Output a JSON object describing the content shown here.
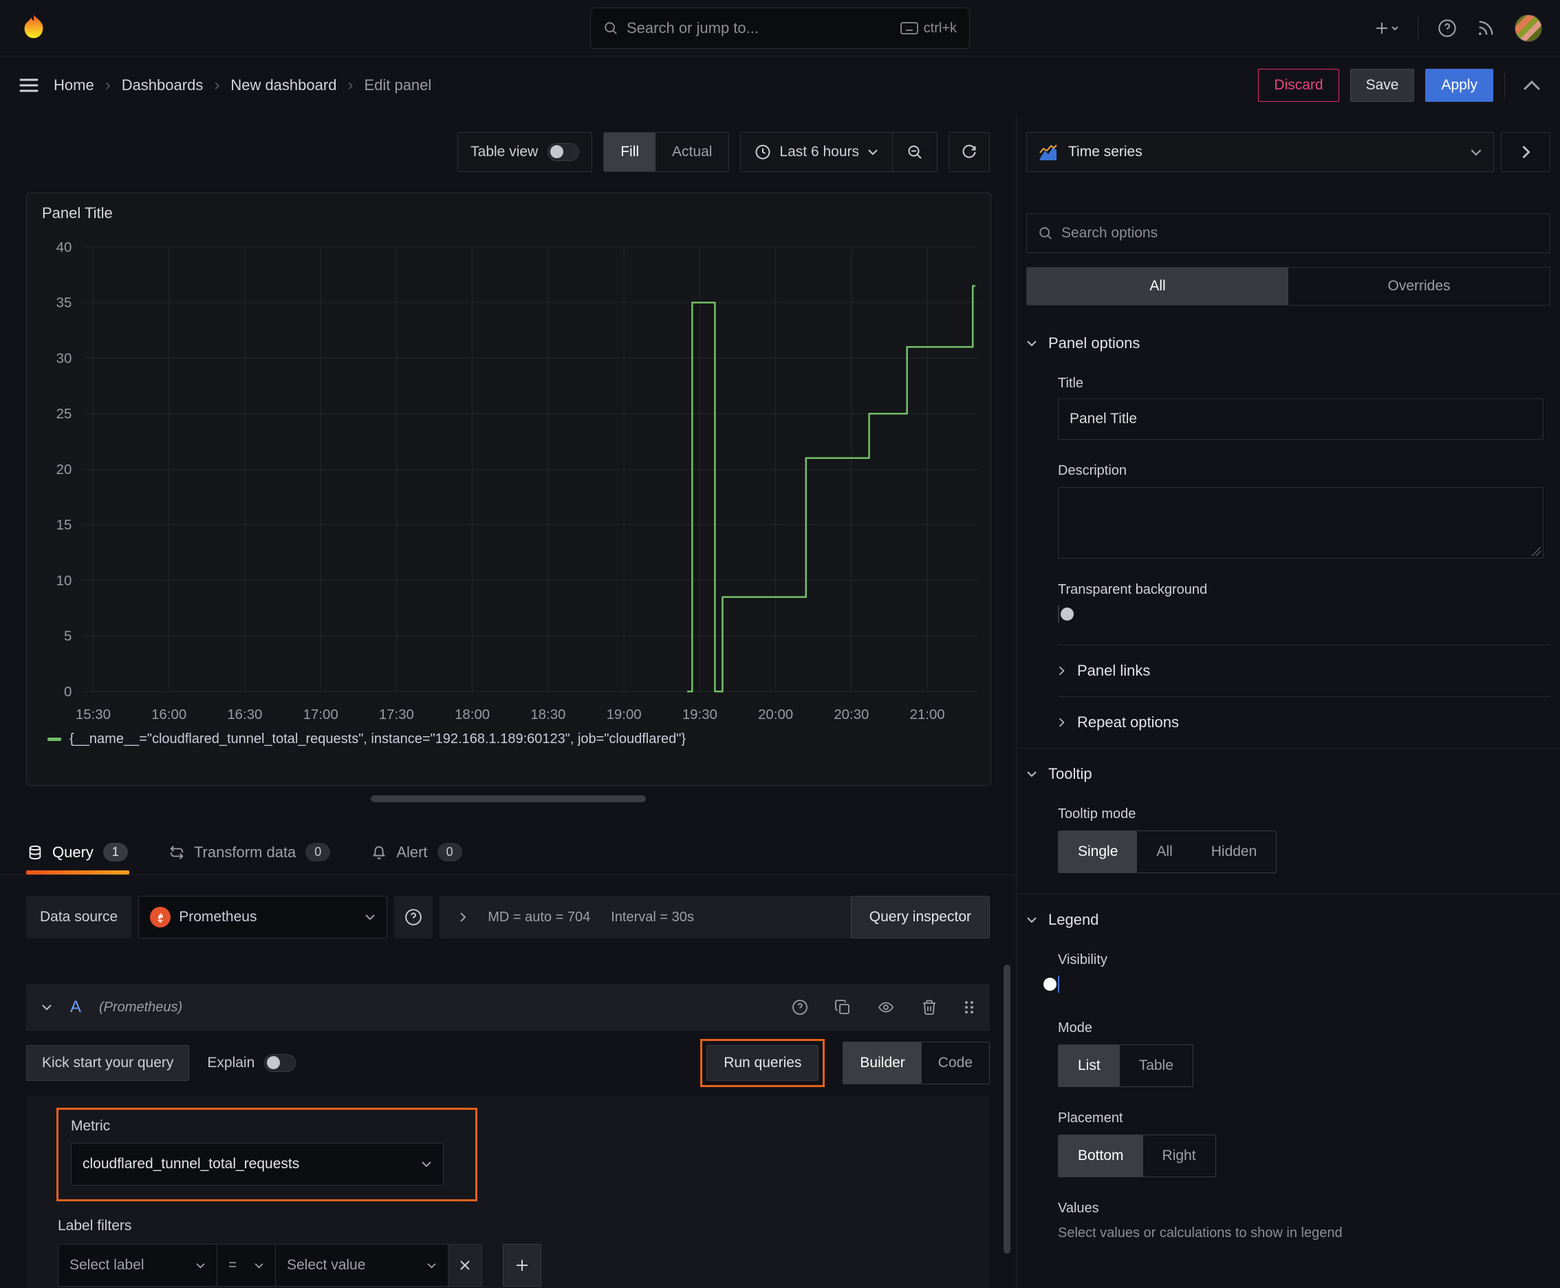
{
  "topbar": {
    "search_placeholder": "Search or jump to...",
    "search_shortcut": "ctrl+k"
  },
  "breadcrumb": {
    "items": [
      {
        "label": "Home"
      },
      {
        "label": "Dashboards"
      },
      {
        "label": "New dashboard"
      },
      {
        "label": "Edit panel"
      }
    ]
  },
  "header_actions": {
    "discard": "Discard",
    "save": "Save",
    "apply": "Apply"
  },
  "viz_toolbar": {
    "table_view_label": "Table view",
    "fill": "Fill",
    "actual": "Actual",
    "time_range": "Last 6 hours"
  },
  "panel": {
    "title": "Panel Title"
  },
  "chart_data": {
    "type": "line",
    "line_style": "step-after",
    "title": "Panel Title",
    "x_ticks": [
      "15:30",
      "16:00",
      "16:30",
      "17:00",
      "17:30",
      "18:00",
      "18:30",
      "19:00",
      "19:30",
      "20:00",
      "20:30",
      "21:00"
    ],
    "x_domain": [
      "15:26",
      "21:20"
    ],
    "y_ticks": [
      0,
      5,
      10,
      15,
      20,
      25,
      30,
      35,
      40
    ],
    "ylim": [
      0,
      40
    ],
    "grid": true,
    "legend_position": "bottom",
    "series": [
      {
        "name": "{__name__=\"cloudflared_tunnel_total_requests\", instance=\"192.168.1.189:60123\", job=\"cloudflared\"}",
        "color": "#73bf69",
        "points": [
          [
            "19:25",
            0
          ],
          [
            "19:27",
            0
          ],
          [
            "19:27",
            35
          ],
          [
            "19:36",
            35
          ],
          [
            "19:36",
            0
          ],
          [
            "19:39",
            0
          ],
          [
            "19:39",
            8.5
          ],
          [
            "20:12",
            8.5
          ],
          [
            "20:12",
            21
          ],
          [
            "20:37",
            21
          ],
          [
            "20:37",
            25
          ],
          [
            "20:52",
            25
          ],
          [
            "20:52",
            31
          ],
          [
            "21:18",
            31
          ],
          [
            "21:18",
            36.5
          ],
          [
            "21:19",
            36.5
          ]
        ]
      }
    ]
  },
  "editor_tabs": {
    "query": {
      "label": "Query",
      "badge": "1"
    },
    "transform": {
      "label": "Transform data",
      "badge": "0"
    },
    "alert": {
      "label": "Alert",
      "badge": "0"
    }
  },
  "datasource_bar": {
    "label": "Data source",
    "name": "Prometheus",
    "stats_md": "MD = auto = 704",
    "stats_interval": "Interval = 30s",
    "inspector": "Query inspector"
  },
  "query_a": {
    "ref_id": "A",
    "datasource": "(Prometheus)"
  },
  "query_toolbar": {
    "kick_start": "Kick start your query",
    "explain": "Explain",
    "run_queries": "Run queries",
    "builder": "Builder",
    "code": "Code"
  },
  "query_editor": {
    "metric_label": "Metric",
    "metric_value": "cloudflared_tunnel_total_requests",
    "label_filters_label": "Label filters",
    "select_label": "Select label",
    "operator": "=",
    "select_value": "Select value"
  },
  "options_pane": {
    "visualization": "Time series",
    "search_placeholder": "Search options",
    "tab_all": "All",
    "tab_overrides": "Overrides",
    "panel_options": {
      "header": "Panel options",
      "title_label": "Title",
      "title_value": "Panel Title",
      "description_label": "Description",
      "transparent_label": "Transparent background"
    },
    "collapsed": {
      "panel_links": "Panel links",
      "repeat_options": "Repeat options"
    },
    "tooltip": {
      "header": "Tooltip",
      "mode_label": "Tooltip mode",
      "single": "Single",
      "all": "All",
      "hidden": "Hidden"
    },
    "legend": {
      "header": "Legend",
      "visibility_label": "Visibility",
      "mode_label": "Mode",
      "list": "List",
      "table": "Table",
      "placement_label": "Placement",
      "bottom": "Bottom",
      "right": "Right",
      "values_label": "Values",
      "values_hint": "Select values or calculations to show in legend"
    }
  },
  "icons": {
    "grafana-logo-icon": "flame",
    "search-icon": "magnifier",
    "keyboard-icon": "keyboard",
    "plus-icon": "+",
    "help-icon": "?",
    "news-icon": "rss",
    "menu-icon": "hamburger",
    "clock-icon": "clock",
    "zoom-out-icon": "magnifier-minus",
    "refresh-icon": "circular-arrows",
    "database-icon": "cylinder",
    "transform-icon": "arrows",
    "bell-icon": "bell",
    "prometheus-icon": "torch",
    "duplicate-icon": "copy",
    "eye-icon": "eye",
    "trash-icon": "bin",
    "drag-handle-icon": "dots"
  },
  "colors": {
    "accent_orange": "#ff780a",
    "annotation_orange": "#e8611c",
    "apply_blue": "#3d71d9",
    "discard_red": "#e0306e",
    "series_green": "#73bf69",
    "toggle_on_blue": "#3d71d9",
    "refid_blue": "#6e9fff"
  }
}
